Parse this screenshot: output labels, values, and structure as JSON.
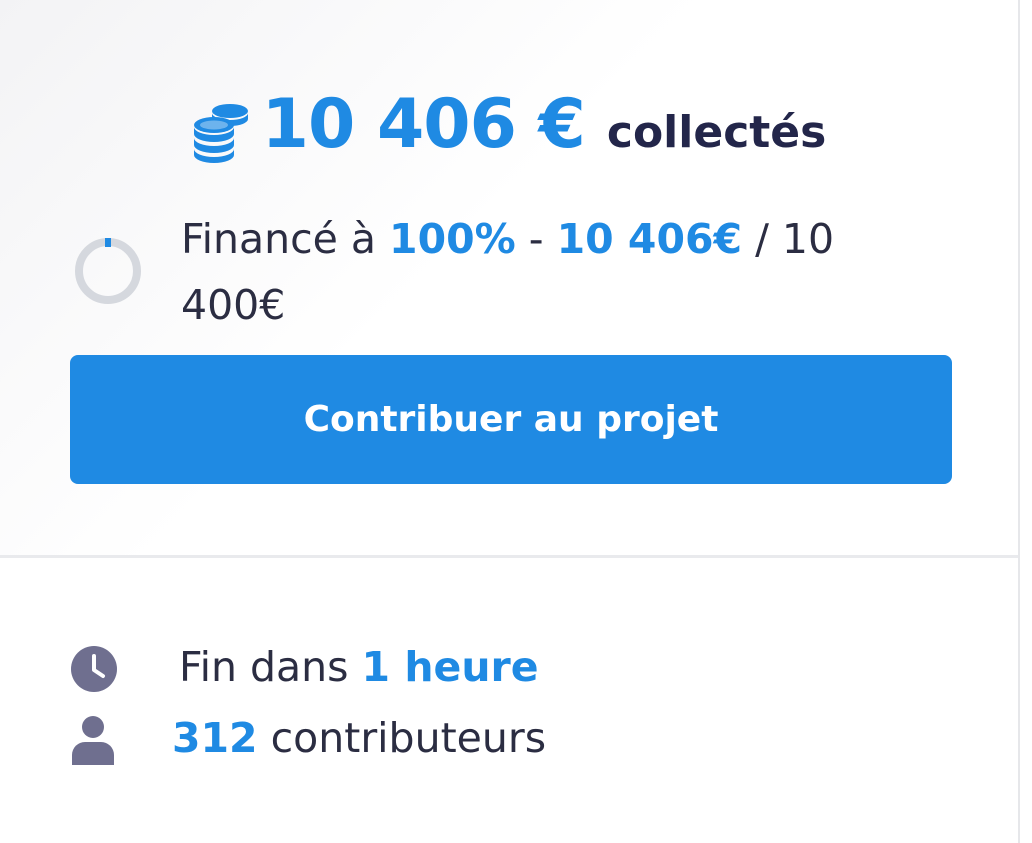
{
  "campaign": {
    "amount": "10 406 €",
    "amount_suffix": "collectés",
    "coins_icon": "coins-icon",
    "funding": {
      "prefix": "Financé à ",
      "percent": "100%",
      "separator": " - ",
      "raised": "10 406€",
      "goal_text": " / 10 400€",
      "progress_fraction": 1.0
    },
    "cta_label": "Contribuer au projet",
    "end": {
      "icon": "clock-icon",
      "prefix": "Fin dans ",
      "value": "1 heure"
    },
    "contributors": {
      "icon": "user-icon",
      "count": "312",
      "label": " contributeurs"
    }
  },
  "colors": {
    "accent": "#1f8ae3",
    "text_dark": "#23264a",
    "icon_gray": "#6f6f8f",
    "ring_gray": "#d5d8de"
  }
}
